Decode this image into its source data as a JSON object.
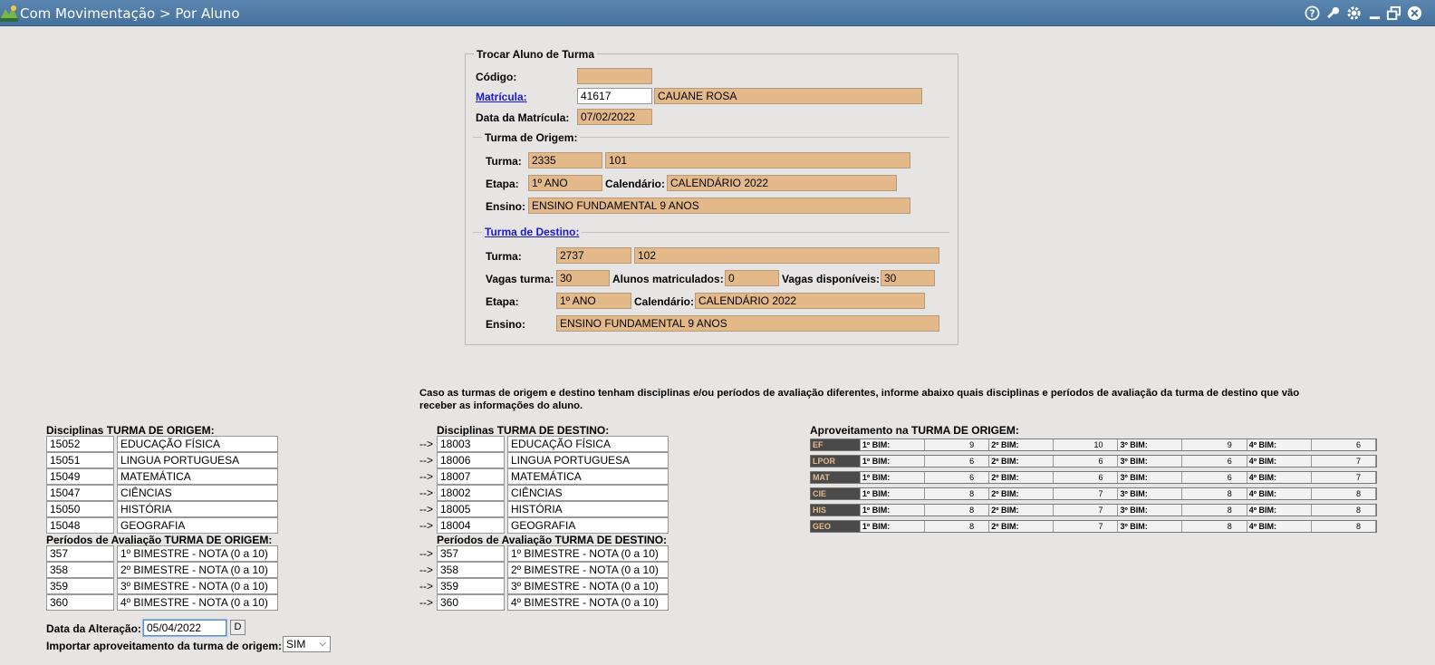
{
  "window": {
    "title": "Com Movimentação > Por Aluno"
  },
  "trocar": {
    "legend": "Trocar Aluno de Turma",
    "codigo_label": "Código:",
    "codigo_value": "",
    "matricula_label": "Matrícula:",
    "matricula_value": "41617",
    "aluno_nome": "CAUANE ROSA",
    "data_matricula_label": "Data da Matrícula:",
    "data_matricula_value": "07/02/2022"
  },
  "origem": {
    "legend": "Turma de Origem:",
    "turma_label": "Turma:",
    "turma_code": "2335",
    "turma_name": "101",
    "etapa_label": "Etapa:",
    "etapa_value": "1º ANO",
    "calendario_label": "Calendário:",
    "calendario_value": "CALENDÁRIO 2022",
    "ensino_label": "Ensino:",
    "ensino_value": "ENSINO FUNDAMENTAL 9 ANOS"
  },
  "destino": {
    "legend": "Turma de Destino:",
    "turma_label": "Turma:",
    "turma_code": "2737",
    "turma_name": "102",
    "vagas_label": "Vagas turma:",
    "vagas_value": "30",
    "alunos_label": "Alunos matriculados:",
    "alunos_value": "0",
    "disp_label": "Vagas disponíveis:",
    "disp_value": "30",
    "etapa_label": "Etapa:",
    "etapa_value": "1º ANO",
    "calendario_label": "Calendário:",
    "calendario_value": "CALENDÁRIO 2022",
    "ensino_label": "Ensino:",
    "ensino_value": "ENSINO FUNDAMENTAL 9 ANOS"
  },
  "info_text_1": "Caso as turmas de origem e destino tenham disciplinas e/ou períodos de avaliação diferentes, informe abaixo quais disciplinas e períodos de avaliação da turma de destino que vão",
  "info_text_2": "receber as informações do aluno.",
  "arrow": "-->",
  "disc_origem": {
    "title": "Disciplinas TURMA DE ORIGEM:",
    "rows": [
      {
        "code": "15052",
        "name": "EDUCAÇÃO FÍSICA"
      },
      {
        "code": "15051",
        "name": "LINGUA PORTUGUESA"
      },
      {
        "code": "15049",
        "name": "MATEMÁTICA"
      },
      {
        "code": "15047",
        "name": "CIÊNCIAS"
      },
      {
        "code": "15050",
        "name": "HISTÓRIA"
      },
      {
        "code": "15048",
        "name": "GEOGRAFIA"
      }
    ]
  },
  "disc_destino": {
    "title": "Disciplinas TURMA DE DESTINO:",
    "rows": [
      {
        "code": "18003",
        "name": "EDUCAÇÃO FÍSICA"
      },
      {
        "code": "18006",
        "name": "LINGUA PORTUGUESA"
      },
      {
        "code": "18007",
        "name": "MATEMÁTICA"
      },
      {
        "code": "18002",
        "name": "CIÊNCIAS"
      },
      {
        "code": "18005",
        "name": "HISTÓRIA"
      },
      {
        "code": "18004",
        "name": "GEOGRAFIA"
      }
    ]
  },
  "per_origem": {
    "title": "Períodos de Avaliação TURMA DE ORIGEM:",
    "rows": [
      {
        "code": "357",
        "name": "1º BIMESTRE - NOTA (0 a 10)"
      },
      {
        "code": "358",
        "name": "2º BIMESTRE - NOTA (0 a 10)"
      },
      {
        "code": "359",
        "name": "3º BIMESTRE - NOTA (0 a 10)"
      },
      {
        "code": "360",
        "name": "4º BIMESTRE - NOTA (0 a 10)"
      }
    ]
  },
  "per_destino": {
    "title": "Períodos de Avaliação TURMA DE DESTINO:",
    "rows": [
      {
        "code": "357",
        "name": "1º BIMESTRE - NOTA (0 a 10)"
      },
      {
        "code": "358",
        "name": "2º BIMESTRE - NOTA (0 a 10)"
      },
      {
        "code": "359",
        "name": "3º BIMESTRE - NOTA (0 a 10)"
      },
      {
        "code": "360",
        "name": "4º BIMESTRE - NOTA (0 a 10)"
      }
    ]
  },
  "aproveitamento": {
    "title": "Aproveitamento na TURMA DE ORIGEM:",
    "bim_labels": [
      "1º BIM:",
      "2º BIM:",
      "3º BIM:",
      "4º BIM:"
    ],
    "rows": [
      {
        "code": "EF",
        "values": [
          "9",
          "10",
          "9",
          "6"
        ]
      },
      {
        "code": "LPOR",
        "values": [
          "6",
          "6",
          "6",
          "7"
        ]
      },
      {
        "code": "MAT",
        "values": [
          "6",
          "6",
          "6",
          "7"
        ]
      },
      {
        "code": "CIE",
        "values": [
          "8",
          "7",
          "8",
          "8"
        ]
      },
      {
        "code": "HIS",
        "values": [
          "8",
          "7",
          "8",
          "8"
        ]
      },
      {
        "code": "GEO",
        "values": [
          "8",
          "7",
          "8",
          "8"
        ]
      }
    ]
  },
  "footer": {
    "data_alteracao_label": "Data da Alteração:",
    "data_alteracao_value": "05/04/2022",
    "d_button": "D",
    "importar_label": "Importar aproveitamento da turma de origem:",
    "importar_value": "SIM"
  }
}
